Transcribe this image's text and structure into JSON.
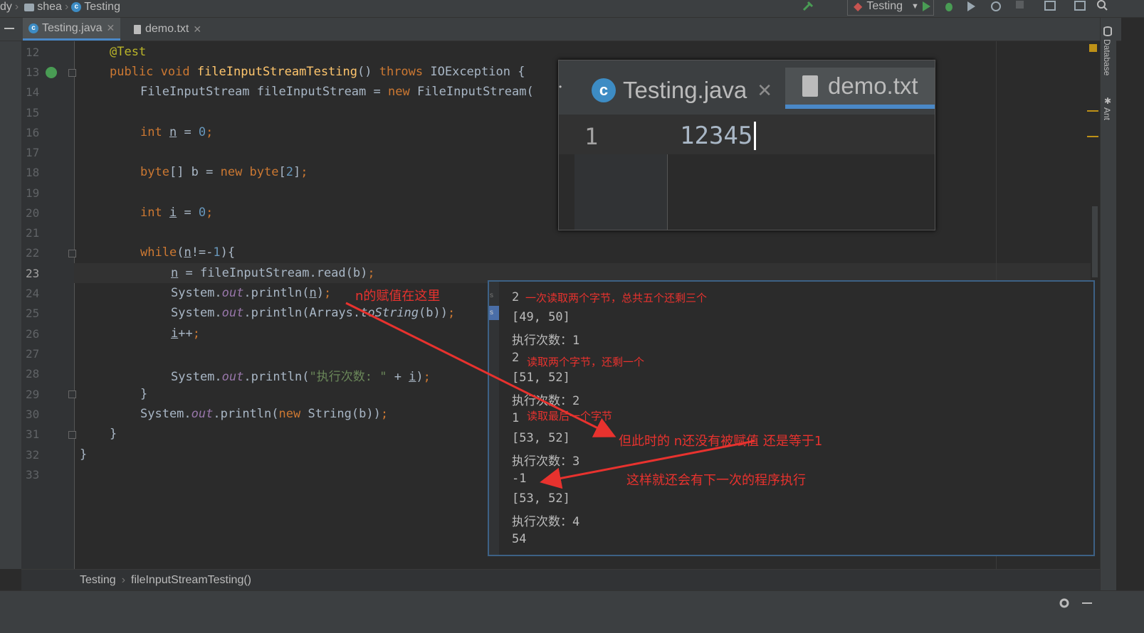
{
  "navbar": {
    "crumbs": [
      "dy",
      "shea",
      "Testing"
    ],
    "run_config": "Testing"
  },
  "tabs": [
    {
      "label": "Testing.java",
      "active": true,
      "icon": "java-class-icon"
    },
    {
      "label": "demo.txt",
      "active": false,
      "icon": "text-file-icon"
    }
  ],
  "editor": {
    "line_numbers": [
      "12",
      "13",
      "14",
      "15",
      "16",
      "17",
      "18",
      "19",
      "20",
      "21",
      "22",
      "23",
      "24",
      "25",
      "26",
      "27",
      "28",
      "29",
      "30",
      "31",
      "32",
      "33"
    ],
    "current_line": "23"
  },
  "right_strip": {
    "database": "Database",
    "ant": "Ant"
  },
  "breadcrumb": {
    "class": "Testing",
    "method": "fileInputStreamTesting()"
  },
  "overlay_demo": {
    "tab_java": "Testing.java",
    "tab_txt": "demo.txt",
    "line_number": "1",
    "content": "12345"
  },
  "console": {
    "lines": [
      "2",
      "[49, 50]",
      "执行次数：1",
      "2",
      "[51, 52]",
      "执行次数：2",
      "1",
      "[53, 52]",
      "执行次数：3",
      "-1",
      "[53, 52]",
      "执行次数：4",
      "54"
    ],
    "strip_labels": [
      "s",
      "s"
    ]
  },
  "annotations": {
    "n_assign": "n的赋值在这里",
    "read_two_total": "一次读取两个字节，总共五个还剩三个",
    "read_two_left_one": "读取两个字节，还剩一个",
    "read_last": "读取最后一个字节",
    "not_assigned": "但此时的 n还没有被赋值 还是等于1",
    "next_run": "这样就还会有下一次的程序执行"
  },
  "colors": {
    "annotation": "#e8322e",
    "accent": "#4a88c7",
    "keyword": "#cc7832"
  }
}
